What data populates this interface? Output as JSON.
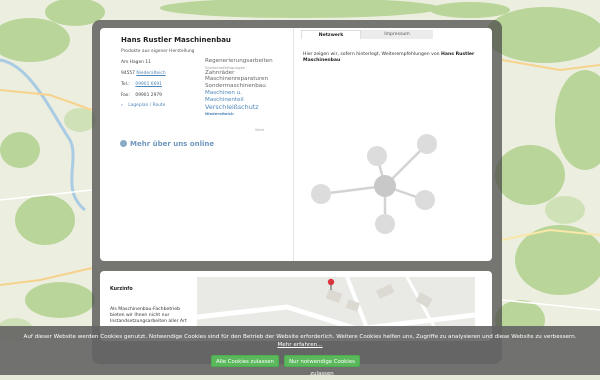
{
  "company": {
    "name": "Hans Rustler Maschinenbau",
    "subtitle": "Produkte aus eigener Herstellung",
    "street": "Am Hagen 11",
    "zip": "94557",
    "city": "Niederalteich",
    "phone_label": "Tel.:",
    "phone": "09901 6691",
    "fax_label": "Fax:",
    "fax": "09901 2979",
    "route_link": "Lageplan / Route",
    "more_link": "Mehr über uns online"
  },
  "tags": [
    {
      "text": "Regenerierungsarbeiten",
      "style": "tag"
    },
    {
      "text": "Sonderanfertigungen",
      "style": "tag small"
    },
    {
      "text": "Zahnräder",
      "style": "tag"
    },
    {
      "text": "Maschinenreparaturen",
      "style": "tag"
    },
    {
      "text": "Sondermaschinenbau",
      "style": "tag"
    },
    {
      "text": "Maschinen u.",
      "style": "tag link"
    },
    {
      "text": "Maschinenteil",
      "style": "tag link"
    },
    {
      "text": "Verschleißschutz",
      "style": "tag big"
    },
    {
      "text": "Niederalteich",
      "style": "tag small bold"
    }
  ],
  "tags_aside": "Wele",
  "tabs": {
    "network": "Netzwerk",
    "imprint": "Impressum"
  },
  "network": {
    "description_prefix": "Hier zeigen wir, sofern hinterlegt, Weiterempfehlungen von",
    "description_company": "Hans Rustler Maschinenbau",
    "hub_color": "#c8c8c8",
    "satellite_color": "#dcdcdc",
    "line_color": "#d3d3d3"
  },
  "kurzinfo": {
    "title": "Kurzinfo",
    "text": "Als Maschinenbau-Fachbetrieb bieten wir Ihnen nicht nur Instandsetzungsarbeiten aller Art"
  },
  "cookie": {
    "text": "Auf dieser Website werden Cookies genutzt. Notwendige Cookies sind für den Betrieb der Website erforderlich. Weitere Cookies helfen uns, Zugriffe zu analysieren und diese Website zu verbessern.",
    "more_link": "Mehr erfahren...",
    "btn_all": "Alle Cookies zulassen",
    "btn_necessary": "Nur notwendige Cookies zulassen"
  },
  "colors": {
    "accent_link": "#4f86b8",
    "button_green": "#5cb85c",
    "map_marker": "#d9363e"
  }
}
